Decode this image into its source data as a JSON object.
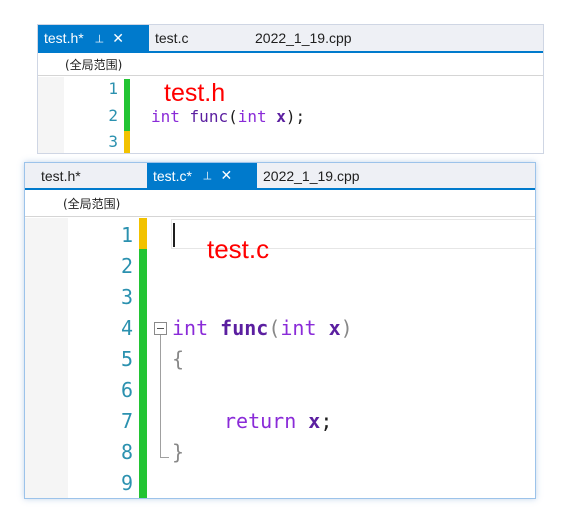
{
  "top_window": {
    "tabs": [
      {
        "label": "test.h*",
        "active": true,
        "pin": "pin-icon",
        "close": "✕"
      },
      {
        "label": "test.c",
        "active": false
      },
      {
        "label": "2022_1_19.cpp",
        "active": false
      }
    ],
    "scope": "(全局范围)",
    "annotation": "test.h",
    "line_numbers": [
      "1",
      "2",
      "3"
    ],
    "code_line_2": {
      "kw1": "int",
      "fn": "func",
      "paren_open": "(",
      "kw2": "int",
      "param": "x",
      "tail": ");"
    }
  },
  "bottom_window": {
    "tabs": [
      {
        "label": "test.h*",
        "active": false
      },
      {
        "label": "test.c*",
        "active": true,
        "pin": "pin-icon",
        "close": "✕"
      },
      {
        "label": "2022_1_19.cpp",
        "active": false
      }
    ],
    "scope": "(全局范围)",
    "annotation": "test.c",
    "line_numbers": [
      "1",
      "2",
      "3",
      "4",
      "5",
      "6",
      "7",
      "8",
      "9"
    ],
    "code": {
      "l4_kw1": "int",
      "l4_fn": "func",
      "l4_open": "(",
      "l4_kw2": "int",
      "l4_param": "x",
      "l4_close": ")",
      "l5": "{",
      "l7_kw": "return",
      "l7_val": "x",
      "l7_semi": ";",
      "l8": "}"
    }
  },
  "colors": {
    "accent": "#007acc",
    "changed": "#22c433",
    "unsaved": "#f2c200",
    "annotation": "#ff0000",
    "line_number": "#2b91af",
    "keyword": "#8a2bd8"
  }
}
